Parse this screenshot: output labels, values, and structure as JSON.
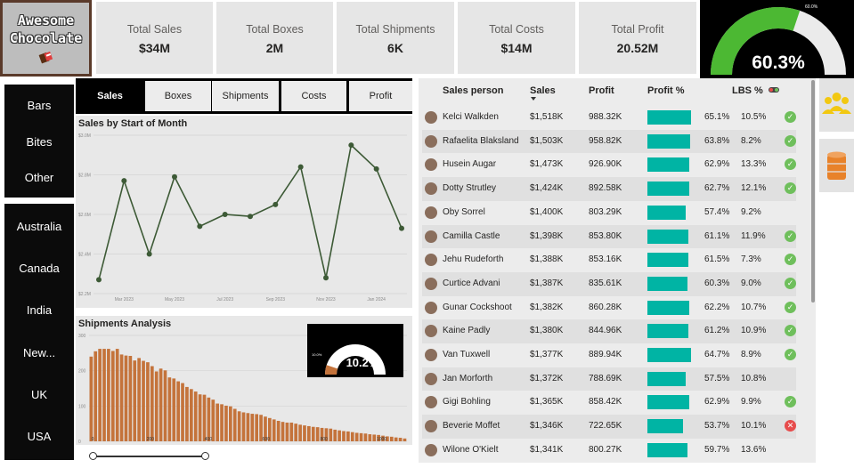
{
  "brand": {
    "line1": "Awesome",
    "line2": "Chocolate"
  },
  "kpis": [
    {
      "label": "Total Sales",
      "value": "$34M"
    },
    {
      "label": "Total Boxes",
      "value": "2M"
    },
    {
      "label": "Total Shipments",
      "value": "6K"
    },
    {
      "label": "Total Costs",
      "value": "$14M"
    },
    {
      "label": "Total Profit",
      "value": "20.52M"
    }
  ],
  "profit_gauge": {
    "value": "60.3%",
    "tick": "60.0%",
    "fill_fraction": 0.603,
    "fill_color": "#4cb833",
    "track_color": "#ebebeb"
  },
  "products": [
    "Bars",
    "Bites",
    "Other"
  ],
  "countries": [
    "Australia",
    "Canada",
    "India",
    "New...",
    "UK",
    "USA"
  ],
  "tabs": [
    "Sales",
    "Boxes",
    "Shipments",
    "Costs",
    "Profit"
  ],
  "active_tab": "Sales",
  "chart_data": [
    {
      "type": "line",
      "title": "Sales by Start of Month",
      "y_ticks": [
        "$3.0M",
        "$2.8M",
        "$2.6M",
        "$2.4M",
        "$2.2M"
      ],
      "x_ticks": [
        "Mar 2023",
        "May 2023",
        "Jul 2023",
        "Sep 2023",
        "Nov 2023",
        "Jan 2024"
      ],
      "ylim": [
        2.2,
        3.0
      ],
      "x": [
        "2023-02",
        "2023-03",
        "2023-04",
        "2023-05",
        "2023-06",
        "2023-07",
        "2023-08",
        "2023-09",
        "2023-10",
        "2023-11",
        "2023-12",
        "2024-01",
        "2024-02"
      ],
      "series": [
        {
          "values": [
            2.27,
            2.77,
            2.4,
            2.79,
            2.54,
            2.6,
            2.59,
            2.65,
            2.84,
            2.28,
            2.95,
            2.83,
            2.53
          ]
        }
      ],
      "color": "#3d5a36"
    },
    {
      "type": "bar",
      "title": "Shipments Analysis",
      "y_ticks": [
        "300",
        "200",
        "100",
        "0"
      ],
      "x_ticks": [
        "0",
        "200",
        "400",
        "600",
        "800",
        "1000"
      ],
      "ylim": [
        0,
        300
      ],
      "xlim": [
        0,
        1100
      ],
      "values": [
        240,
        255,
        262,
        262,
        262,
        256,
        262,
        246,
        243,
        242,
        229,
        236,
        228,
        224,
        213,
        198,
        206,
        201,
        181,
        178,
        170,
        165,
        154,
        148,
        141,
        133,
        132,
        124,
        118,
        107,
        105,
        101,
        99,
        92,
        85,
        82,
        80,
        78,
        77,
        75,
        70,
        66,
        62,
        58,
        55,
        53,
        53,
        50,
        47,
        45,
        43,
        41,
        40,
        38,
        37,
        36,
        33,
        31,
        29,
        28,
        26,
        24,
        23,
        22,
        20,
        19,
        18,
        16,
        14,
        13,
        11,
        10,
        8
      ],
      "color": "#c4733b"
    }
  ],
  "shipment_gauge": {
    "value": "10.2%",
    "tick": "10.0%",
    "fill_fraction": 0.102,
    "fill_color": "#c4733b",
    "track_color": "#ffffff"
  },
  "table": {
    "headers": [
      "Sales person",
      "Sales",
      "Profit",
      "Profit %",
      "LBS %"
    ],
    "rows": [
      {
        "name": "Kelci Walkden",
        "sales": "$1,518K",
        "profit": "988.32K",
        "pct": "65.1%",
        "pct_value": 0.651,
        "lbs": "10.5%",
        "status": "ok"
      },
      {
        "name": "Rafaelita Blaksland",
        "sales": "$1,503K",
        "profit": "958.82K",
        "pct": "63.8%",
        "pct_value": 0.638,
        "lbs": "8.2%",
        "status": "ok"
      },
      {
        "name": "Husein Augar",
        "sales": "$1,473K",
        "profit": "926.90K",
        "pct": "62.9%",
        "pct_value": 0.629,
        "lbs": "13.3%",
        "status": "ok"
      },
      {
        "name": "Dotty Strutley",
        "sales": "$1,424K",
        "profit": "892.58K",
        "pct": "62.7%",
        "pct_value": 0.627,
        "lbs": "12.1%",
        "status": "ok"
      },
      {
        "name": "Oby Sorrel",
        "sales": "$1,400K",
        "profit": "803.29K",
        "pct": "57.4%",
        "pct_value": 0.574,
        "lbs": "9.2%",
        "status": ""
      },
      {
        "name": "Camilla Castle",
        "sales": "$1,398K",
        "profit": "853.80K",
        "pct": "61.1%",
        "pct_value": 0.611,
        "lbs": "11.9%",
        "status": "ok"
      },
      {
        "name": "Jehu Rudeforth",
        "sales": "$1,388K",
        "profit": "853.16K",
        "pct": "61.5%",
        "pct_value": 0.615,
        "lbs": "7.3%",
        "status": "ok"
      },
      {
        "name": "Curtice Advani",
        "sales": "$1,387K",
        "profit": "835.61K",
        "pct": "60.3%",
        "pct_value": 0.603,
        "lbs": "9.0%",
        "status": "ok"
      },
      {
        "name": "Gunar Cockshoot",
        "sales": "$1,382K",
        "profit": "860.28K",
        "pct": "62.2%",
        "pct_value": 0.622,
        "lbs": "10.7%",
        "status": "ok"
      },
      {
        "name": "Kaine Padly",
        "sales": "$1,380K",
        "profit": "844.96K",
        "pct": "61.2%",
        "pct_value": 0.612,
        "lbs": "10.9%",
        "status": "ok"
      },
      {
        "name": "Van Tuxwell",
        "sales": "$1,377K",
        "profit": "889.94K",
        "pct": "64.7%",
        "pct_value": 0.647,
        "lbs": "8.9%",
        "status": "ok"
      },
      {
        "name": "Jan Morforth",
        "sales": "$1,372K",
        "profit": "788.69K",
        "pct": "57.5%",
        "pct_value": 0.575,
        "lbs": "10.8%",
        "status": ""
      },
      {
        "name": "Gigi Bohling",
        "sales": "$1,365K",
        "profit": "858.42K",
        "pct": "62.9%",
        "pct_value": 0.629,
        "lbs": "9.9%",
        "status": "ok"
      },
      {
        "name": "Beverie Moffet",
        "sales": "$1,346K",
        "profit": "722.65K",
        "pct": "53.7%",
        "pct_value": 0.537,
        "lbs": "10.1%",
        "status": "bad"
      },
      {
        "name": "Wilone O'Kielt",
        "sales": "$1,341K",
        "profit": "800.27K",
        "pct": "59.7%",
        "pct_value": 0.597,
        "lbs": "13.6%",
        "status": ""
      }
    ]
  },
  "icons": {
    "team": "people-group-icon",
    "data": "database-icon",
    "legend": "indicator-legend-icon",
    "sort": "sort-down-icon",
    "ok": "check-circle-icon",
    "bad": "x-circle-icon"
  },
  "colors": {
    "teal": "#00b4a4",
    "green": "#4cb833",
    "copper": "#c4733b",
    "orange_icon": "#e8822a",
    "yellow_icon": "#f2c811"
  }
}
